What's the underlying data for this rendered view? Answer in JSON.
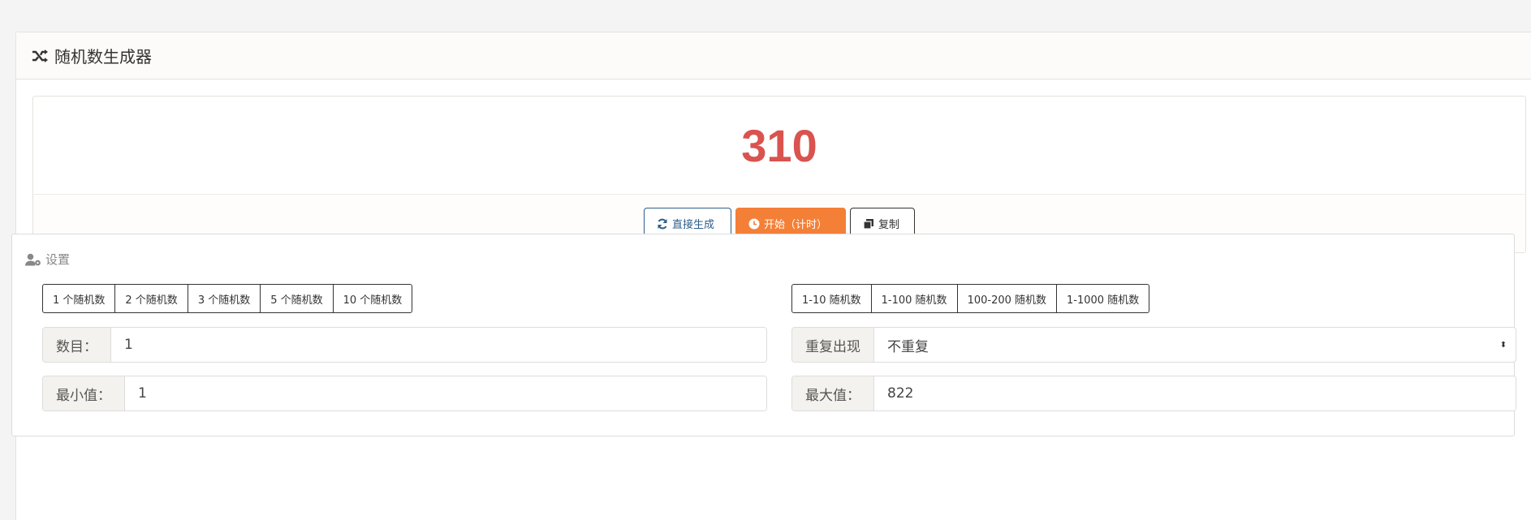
{
  "header": {
    "title": "随机数生成器",
    "icon": "shuffle-icon"
  },
  "result": {
    "value": "310",
    "color": "#d9534f"
  },
  "actions": {
    "generate_label": "直接生成",
    "start_label": "开始（计时）",
    "copy_label": "复制"
  },
  "settings": {
    "title": "设置",
    "count_presets": [
      "1 个随机数",
      "2 个随机数",
      "3 个随机数",
      "5 个随机数",
      "10 个随机数"
    ],
    "range_presets": [
      "1-10 随机数",
      "1-100 随机数",
      "100-200 随机数",
      "1-1000 随机数"
    ],
    "count": {
      "label": "数目：",
      "value": "1"
    },
    "repeat": {
      "label": "重复出现",
      "value": "不重复"
    },
    "min": {
      "label": "最小值：",
      "value": "1"
    },
    "max": {
      "label": "最大值：",
      "value": "822"
    }
  },
  "colors": {
    "accent_orange": "#f47f36",
    "accent_blue": "#2e5e8a"
  }
}
